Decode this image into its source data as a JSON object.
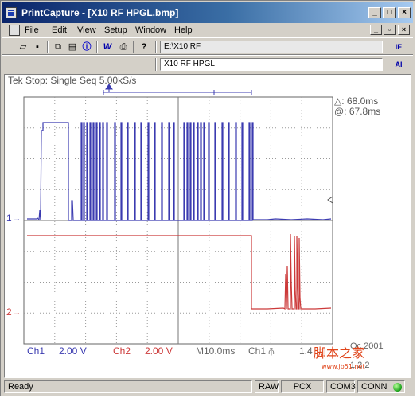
{
  "window": {
    "title": "PrintCapture - [X10 RF HPGL.bmp]"
  },
  "menu": [
    "File",
    "Edit",
    "View",
    "Setup",
    "Window",
    "Help"
  ],
  "toolbar": {
    "path_value": "E:\\X10 RF",
    "name_value": "X10 RF HPGL",
    "right_label_1": "IE",
    "right_label_2": "AI"
  },
  "scope": {
    "header": "Tek Stop: Single Seq  5.00kS/s",
    "delta": "△: 68.0ms",
    "at": "@: 67.8ms",
    "ch1_marker": "1→",
    "ch2_marker": "2→",
    "footer": {
      "ch1_label": "Ch1",
      "ch1_scale": "2.00 V",
      "ch2_label": "Ch2",
      "ch2_scale": "2.00 V",
      "timebase": "M10.0ms",
      "trigger": "Ch1 ⫚",
      "trigger_level": "1.4",
      "date_a": "Oc 2001",
      "date_b": "1 2 2"
    }
  },
  "watermark": {
    "text": "脚本之家",
    "url": "www.jb51.net"
  },
  "status": {
    "ready": "Ready",
    "raw": "RAW",
    "pcx": "PCX",
    "com": "COM3",
    "conn": "CONN"
  },
  "colors": {
    "ch1": "#3b3bb0",
    "ch2": "#cc3a3a",
    "grid": "#888888",
    "title_bar": "#0a246a"
  }
}
